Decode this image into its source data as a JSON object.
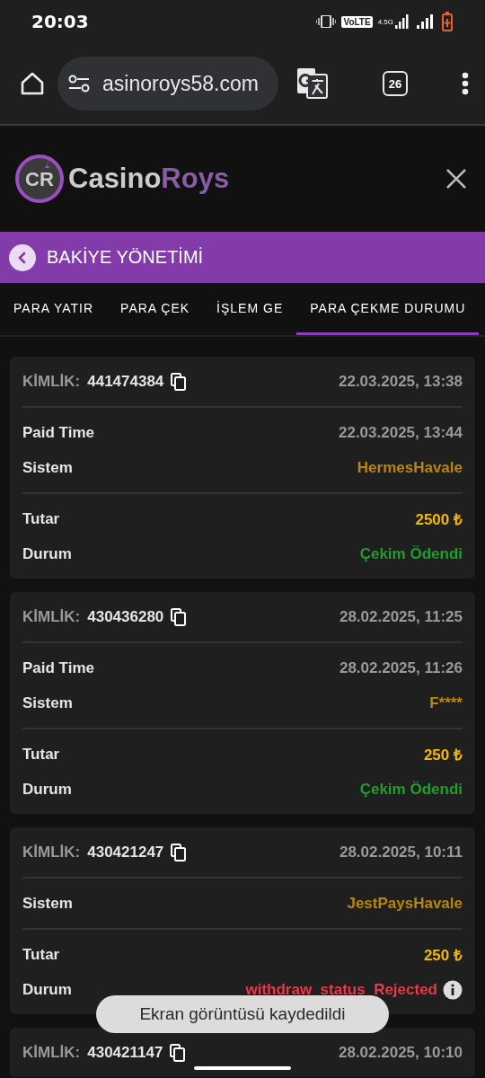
{
  "status_bar": {
    "time": "20:03",
    "volte": "VoLTE",
    "network": "4.5G"
  },
  "browser": {
    "url": "asinoroys58.com",
    "tab_count": "26"
  },
  "header": {
    "logo_monogram": "CR",
    "logo_word_1": "Casino",
    "logo_word_2": "Roys"
  },
  "section_bar": {
    "title": "BAKİYE YÖNETİMİ"
  },
  "tabs": [
    {
      "label": "PARA YATIR",
      "selected": false
    },
    {
      "label": "PARA ÇEK",
      "selected": false
    },
    {
      "label": "İŞLEM GE",
      "selected": false
    },
    {
      "label": "PARA ÇEKME DURUMU",
      "selected": true
    }
  ],
  "cards": [
    {
      "id_label": "KİMLİK:",
      "id": "441474384",
      "date": "22.03.2025, 13:38",
      "groups": [
        [
          {
            "label": "Paid Time",
            "value": "22.03.2025, 13:44",
            "kind": "date"
          },
          {
            "label": "Sistem",
            "value": "HermesHavale",
            "kind": "system"
          }
        ],
        [
          {
            "label": "Tutar",
            "value": "2500 ₺",
            "kind": "amount"
          },
          {
            "label": "Durum",
            "value": "Çekim Ödendi",
            "kind": "paid"
          }
        ]
      ]
    },
    {
      "id_label": "KİMLİK:",
      "id": "430436280",
      "date": "28.02.2025, 11:25",
      "groups": [
        [
          {
            "label": "Paid Time",
            "value": "28.02.2025, 11:26",
            "kind": "date"
          },
          {
            "label": "Sistem",
            "value": "F****",
            "kind": "system"
          }
        ],
        [
          {
            "label": "Tutar",
            "value": "250 ₺",
            "kind": "amount"
          },
          {
            "label": "Durum",
            "value": "Çekim Ödendi",
            "kind": "paid"
          }
        ]
      ]
    },
    {
      "id_label": "KİMLİK:",
      "id": "430421247",
      "date": "28.02.2025, 10:11",
      "groups": [
        [
          {
            "label": "Sistem",
            "value": "JestPaysHavale",
            "kind": "system"
          }
        ],
        [
          {
            "label": "Tutar",
            "value": "250 ₺",
            "kind": "amount"
          },
          {
            "label": "Durum",
            "value": "withdraw_status_Rejected",
            "kind": "rejected"
          }
        ]
      ]
    },
    {
      "id_label": "KİMLİK:",
      "id": "430421147",
      "date": "28.02.2025, 10:10"
    }
  ],
  "toast": {
    "text": "Ekran görüntüsü kaydedildi"
  }
}
